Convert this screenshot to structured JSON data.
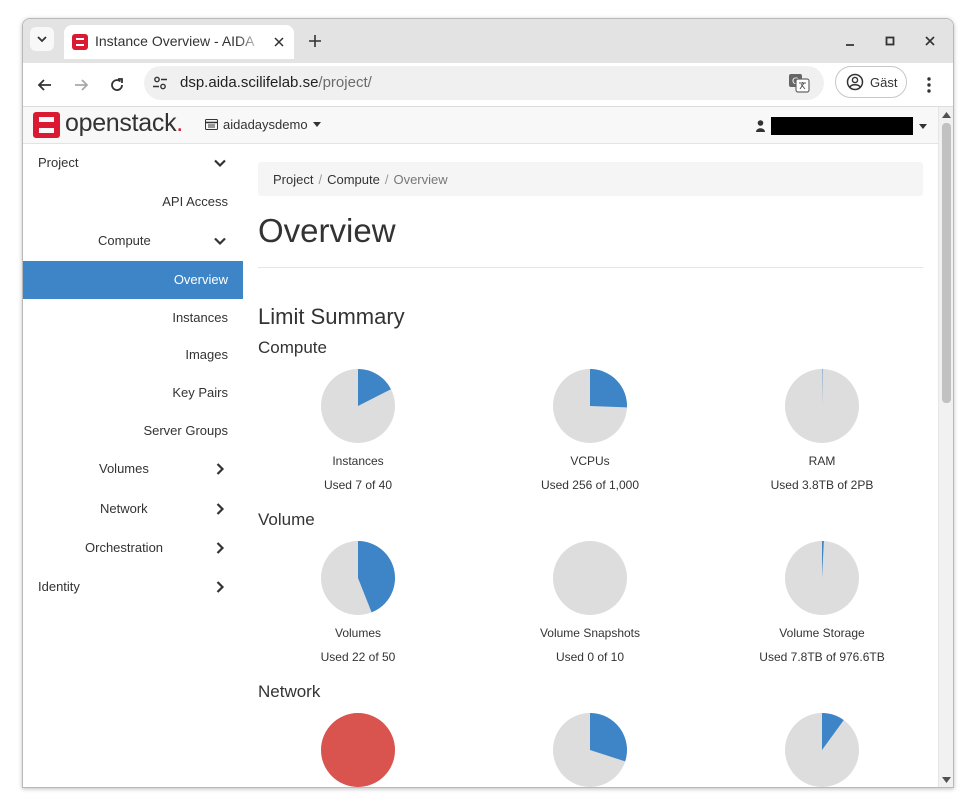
{
  "browser": {
    "tab_title": "Instance Overview - AIDA",
    "url_host": "dsp.aida.scilifelab.se",
    "url_path": "/project/",
    "profile_label": "Gäst"
  },
  "navbar": {
    "logo_text": "openstack",
    "logo_dot": ".",
    "project_name": "aidadaysdemo"
  },
  "sidebar": {
    "items": [
      {
        "label": "Project"
      },
      {
        "label": "API Access"
      },
      {
        "label": "Compute"
      },
      {
        "label": "Overview"
      },
      {
        "label": "Instances"
      },
      {
        "label": "Images"
      },
      {
        "label": "Key Pairs"
      },
      {
        "label": "Server Groups"
      },
      {
        "label": "Volumes"
      },
      {
        "label": "Network"
      },
      {
        "label": "Orchestration"
      },
      {
        "label": "Identity"
      }
    ]
  },
  "main": {
    "breadcrumb": [
      "Project",
      "Compute",
      "Overview"
    ],
    "breadcrumb_sep": "/",
    "title": "Overview",
    "section_title": "Limit Summary",
    "groups": [
      {
        "title": "Compute",
        "charts": [
          {
            "label": "Instances",
            "usage": "Used 7 of 40",
            "fraction": 0.175,
            "color": "#3d85c6"
          },
          {
            "label": "VCPUs",
            "usage": "Used 256 of 1,000",
            "fraction": 0.256,
            "color": "#3d85c6"
          },
          {
            "label": "RAM",
            "usage": "Used 3.8TB of 2PB",
            "fraction": 0.0019,
            "color": "#3d85c6"
          }
        ]
      },
      {
        "title": "Volume",
        "charts": [
          {
            "label": "Volumes",
            "usage": "Used 22 of 50",
            "fraction": 0.44,
            "color": "#3d85c6"
          },
          {
            "label": "Volume Snapshots",
            "usage": "Used 0 of 10",
            "fraction": 0,
            "color": "#3d85c6"
          },
          {
            "label": "Volume Storage",
            "usage": "Used 7.8TB of 976.6TB",
            "fraction": 0.008,
            "color": "#3d85c6"
          }
        ]
      },
      {
        "title": "Network",
        "charts": [
          {
            "fraction": 1,
            "color": "#d9534f"
          },
          {
            "fraction": 0.3,
            "color": "#3d85c6"
          },
          {
            "fraction": 0.1,
            "color": "#3d85c6"
          }
        ]
      }
    ]
  },
  "colors": {
    "accent": "#3d85c6",
    "full": "#d9534f",
    "pie_bg": "#dddddd",
    "openstack_red": "#da1a32"
  }
}
